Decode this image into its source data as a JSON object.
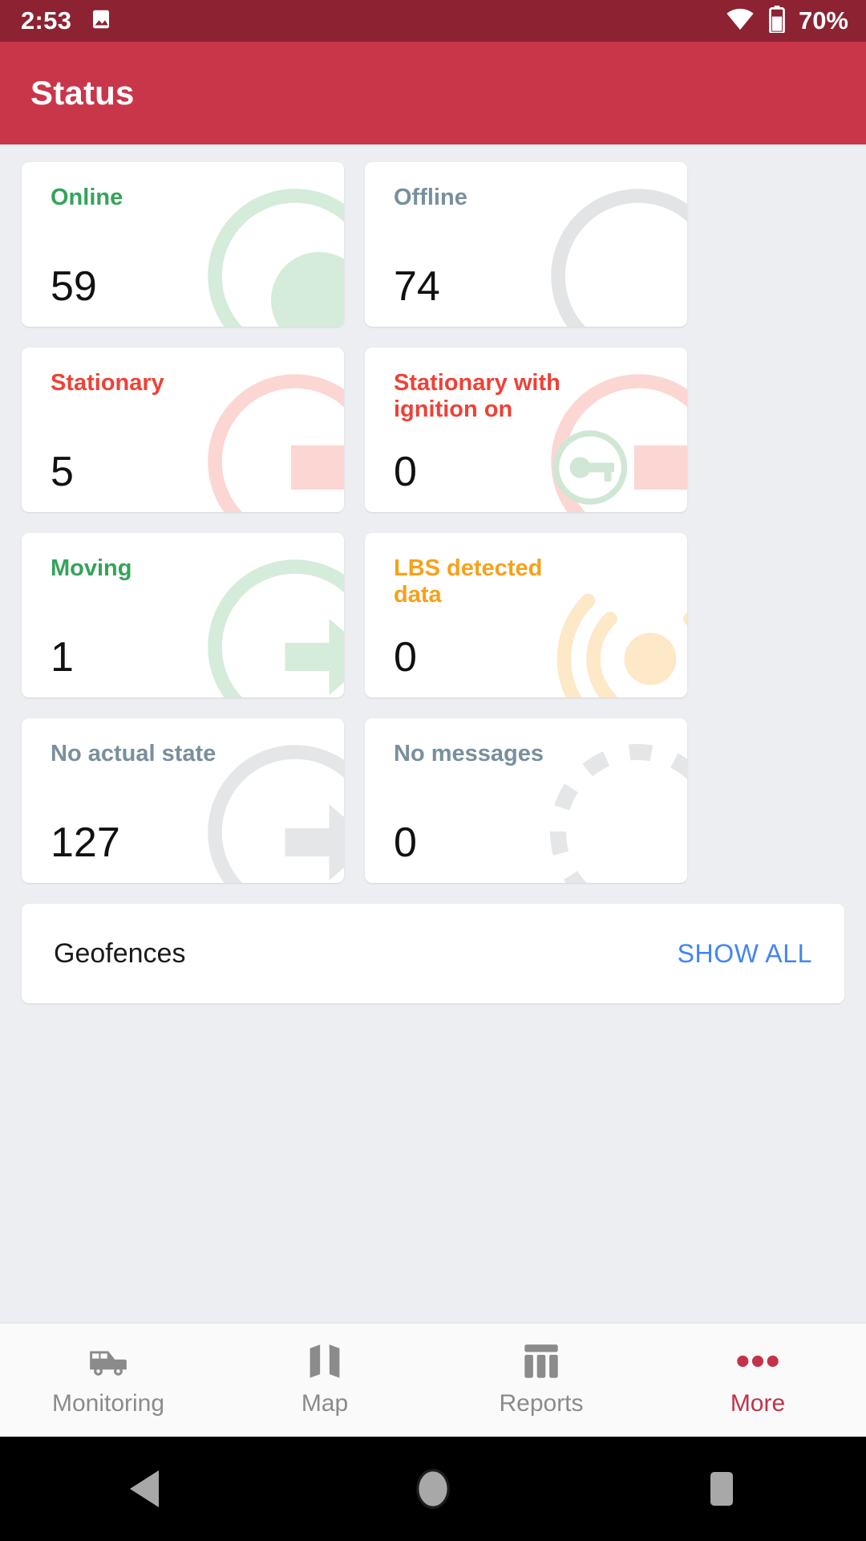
{
  "status_bar": {
    "clock": "2:53",
    "icons": [
      "image-icon",
      "wifi-icon",
      "battery-icon"
    ],
    "battery_text": "70%"
  },
  "app_bar": {
    "title": "Status"
  },
  "cards": [
    {
      "label": "Online",
      "value": "59",
      "color": "#35a35a",
      "icon": "circle-ring-dot-icon",
      "accent": "#d4ecd9"
    },
    {
      "label": "Offline",
      "value": "74",
      "color": "#78909c",
      "icon": "circle-ring-icon",
      "accent": "#e2e4e6"
    },
    {
      "label": "Stationary",
      "value": "5",
      "color": "#ef4136",
      "icon": "stop-bar-ring-icon",
      "accent": "#fbd6d3"
    },
    {
      "label": "Stationary with ignition on",
      "value": "0",
      "color": "#ef4136",
      "icon": "ignition-key-ring-icon",
      "accent": "#fbd6d3"
    },
    {
      "label": "Moving",
      "value": "1",
      "color": "#35a35a",
      "icon": "arrow-ring-icon",
      "accent": "#d4ecd9"
    },
    {
      "label": "LBS detected data",
      "value": "0",
      "color": "#f7a11a",
      "icon": "signal-waves-icon",
      "accent": "#fde8c7"
    },
    {
      "label": "No actual state",
      "value": "127",
      "color": "#78909c",
      "icon": "arrow-ring-icon",
      "accent": "#e4e6e8"
    },
    {
      "label": "No messages",
      "value": "0",
      "color": "#78909c",
      "icon": "dashed-circle-icon",
      "accent": "#e4e6e8"
    }
  ],
  "geofences": {
    "title": "Geofences",
    "action": "SHOW ALL"
  },
  "bottom_nav": {
    "items": [
      {
        "label": "Monitoring",
        "icon": "van-icon",
        "active": false
      },
      {
        "label": "Map",
        "icon": "map-icon",
        "active": false
      },
      {
        "label": "Reports",
        "icon": "columns-icon",
        "active": false
      },
      {
        "label": "More",
        "icon": "dots-icon",
        "active": true
      }
    ]
  },
  "system_nav": {
    "back": "back-triangle-icon",
    "home": "home-circle-icon",
    "recents": "recents-square-icon"
  }
}
